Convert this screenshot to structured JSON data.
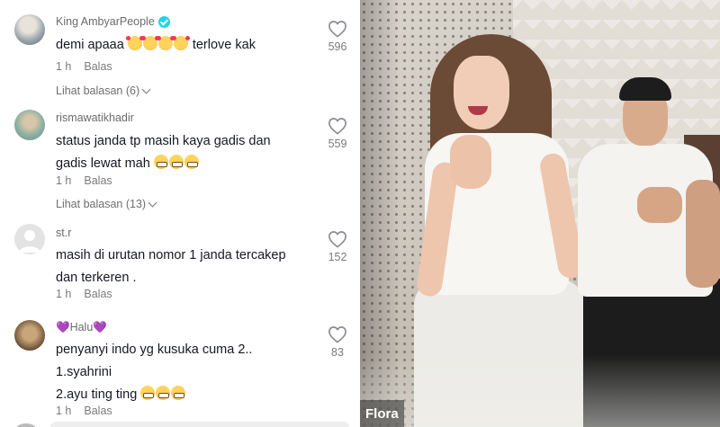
{
  "comments": [
    {
      "username": "King AmbyarPeople",
      "verified": true,
      "text_before": "demi apaaa ",
      "emojis": [
        "smiling-face-with-hearts",
        "smiling-face-with-hearts",
        "smiling-face-with-hearts",
        "smiling-face-with-hearts"
      ],
      "text_after": " terlove kak",
      "time": "1 h",
      "reply_label": "Balas",
      "view_replies": "Lihat balasan (6)",
      "likes": "596"
    },
    {
      "username": "rismawatikhadir",
      "verified": false,
      "line1": "status janda tp masih kaya gadis dan",
      "line2": "gadis lewat mah ",
      "emojis": [
        "grinning-face",
        "grinning-face",
        "grinning-face"
      ],
      "time": "1 h",
      "reply_label": "Balas",
      "view_replies": "Lihat balasan (13)",
      "likes": "559"
    },
    {
      "username": "st.r",
      "verified": false,
      "line1": "masih di urutan nomor 1 janda tercakep",
      "line2": "dan terkeren .",
      "time": "1 h",
      "reply_label": "Balas",
      "likes": "152"
    },
    {
      "username": "💜Halu💜",
      "verified": false,
      "line1": "penyanyi indo yg kusuka cuma 2..",
      "line2": "1.syahrini",
      "line3": "2.ayu ting ting ",
      "emojis": [
        "grinning-face",
        "grinning-face",
        "grinning-face"
      ],
      "time": "1 h",
      "reply_label": "Balas",
      "likes": "83"
    }
  ],
  "video": {
    "creator_label": "Flora"
  },
  "colors": {
    "text": "#161823",
    "muted": "#7a7a7a",
    "verified": "#20d5ec"
  }
}
